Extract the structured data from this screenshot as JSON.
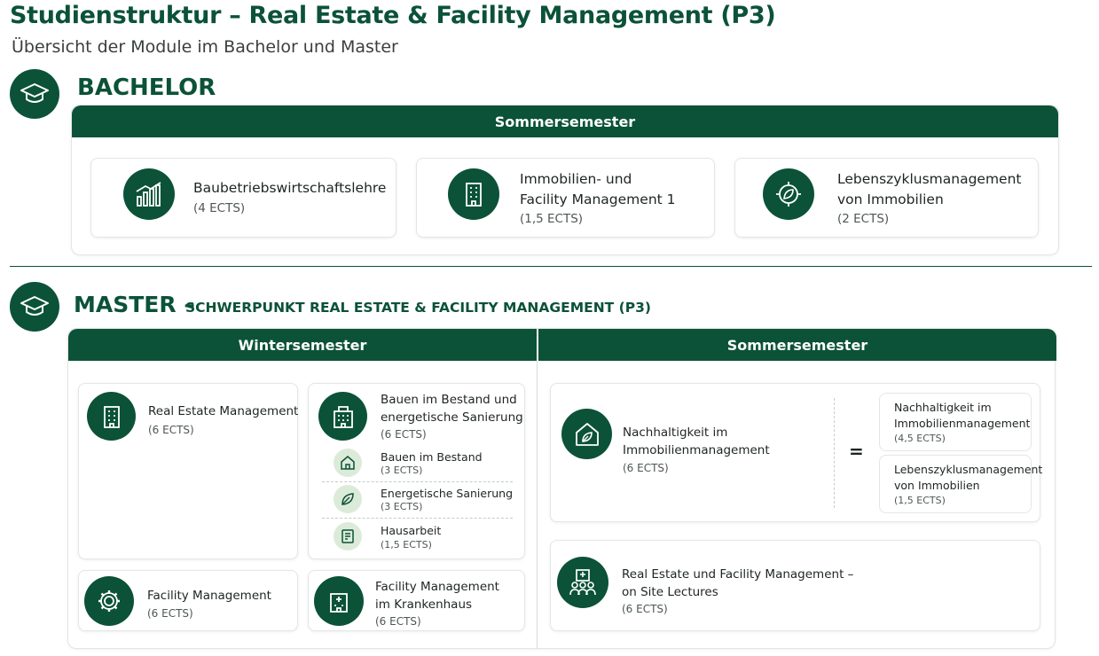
{
  "title": "Studienstruktur – Real Estate & Facility Management (P3)",
  "subtitle": "Übersicht der Module im Bachelor und Master",
  "colors": {
    "primary": "#0b5238",
    "light_green": "#dcebd9"
  },
  "bachelor": {
    "heading": "BACHELOR",
    "icon": "graduation-cap-icon",
    "semester": "Sommersemester",
    "modules": [
      {
        "name": "Baubetriebswirtschaftslehre",
        "ects": "(4 ECTS)",
        "icon": "bar-chart-icon"
      },
      {
        "name_line1": "Immobilien- und",
        "name_line2": "Facility Management 1",
        "ects": "(1,5 ECTS)",
        "icon": "building-icon"
      },
      {
        "name_line1": "Lebenszyklusmanagement",
        "name_line2": "von Immobilien",
        "ects": "(2 ECTS)",
        "icon": "cycle-icon"
      }
    ]
  },
  "master": {
    "heading": "MASTER –",
    "subheading": "SCHWERPUNKT REAL ESTATE & FACILITY MANAGEMENT (P3)",
    "icon": "graduation-cap-icon",
    "winter": {
      "label": "Wintersemester",
      "modules": {
        "rem": {
          "name": "Real Estate Management",
          "ects": "(6 ECTS)",
          "icon": "building-icon"
        },
        "bestand": {
          "name_line1": "Bauen im Bestand und",
          "name_line2": "energetische Sanierung",
          "ects": "(6 ECTS)",
          "icon": "building-icon",
          "sub": [
            {
              "name": "Bauen im Bestand",
              "ects": "(3 ECTS)",
              "icon": "house-icon"
            },
            {
              "name": "Energetische Sanierung",
              "ects": "(3 ECTS)",
              "icon": "leaf-icon"
            },
            {
              "name": "Hausarbeit",
              "ects": "(1,5 ECTS)",
              "icon": "document-icon"
            }
          ]
        },
        "fm": {
          "name": "Facility Management",
          "ects": "(6 ECTS)",
          "icon": "gear-icon"
        },
        "fmk": {
          "name_line1": "Facility Management",
          "name_line2": "im Krankenhaus",
          "ects": "(6 ECTS)",
          "icon": "hospital-icon"
        }
      }
    },
    "summer": {
      "label": "Sommersemester",
      "nachhaltigkeit": {
        "name_line1": "Nachhaltigkeit im",
        "name_line2": "Immobilienmanagement",
        "ects": "(6 ECTS)",
        "icon": "house-leaf-icon",
        "equals": "=",
        "parts": [
          {
            "name_line1": "Nachhaltigkeit im",
            "name_line2": "Immobilienmanagement",
            "ects": "(4,5 ECTS)"
          },
          {
            "name_line1": "Lebenszyklusmanagement",
            "name_line2": "von Immobilien",
            "ects": "(1,5 ECTS)"
          }
        ]
      },
      "onsite": {
        "name_line1": "Real Estate und Facility Management –",
        "name_line2": "on Site Lectures",
        "ects": "(6 ECTS)",
        "icon": "people-building-icon"
      }
    }
  }
}
